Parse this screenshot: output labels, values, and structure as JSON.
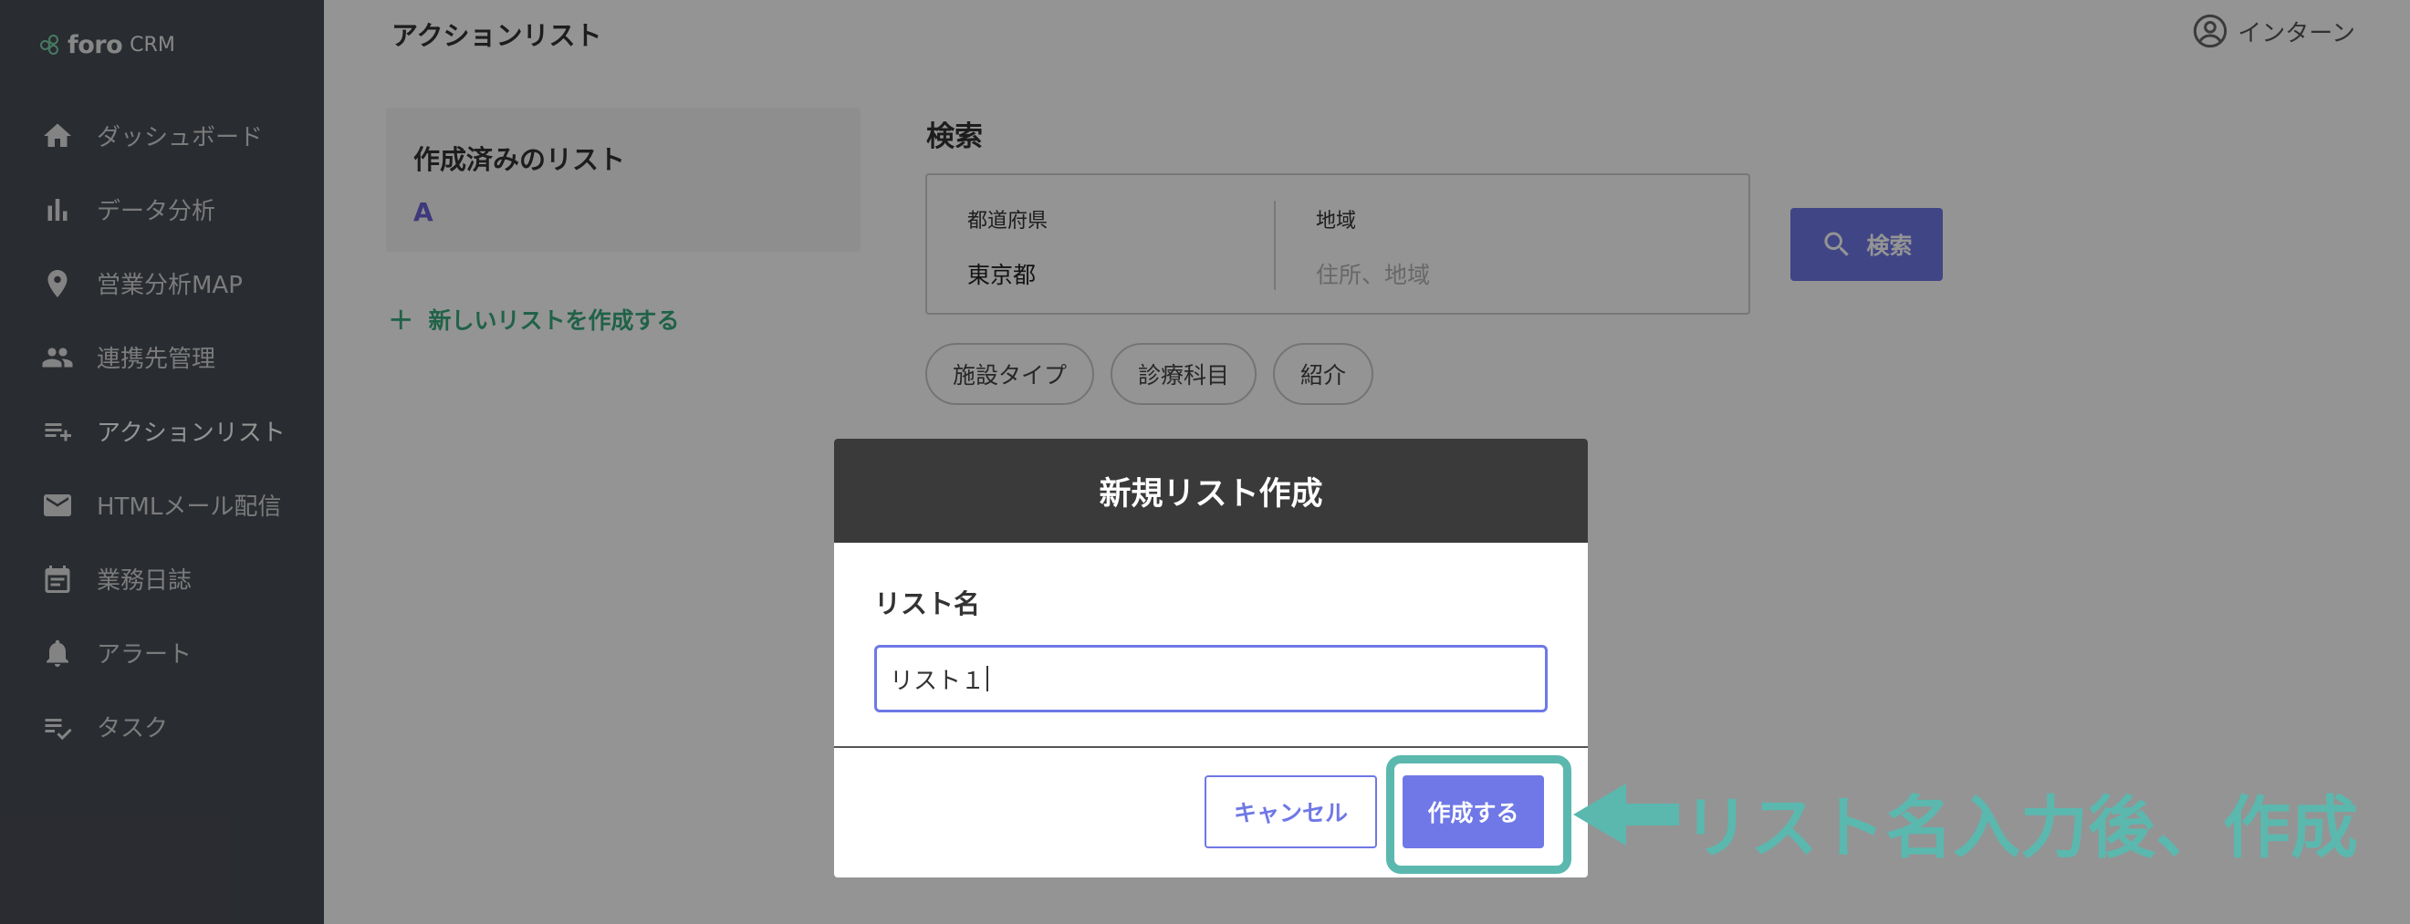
{
  "app": {
    "brand": "foro",
    "brand_suffix": "CRM"
  },
  "sidebar": {
    "items": [
      {
        "label": "ダッシュボード",
        "icon": "home-icon",
        "active": false
      },
      {
        "label": "データ分析",
        "icon": "bar-chart-icon",
        "active": false
      },
      {
        "label": "営業分析MAP",
        "icon": "map-pin-icon",
        "active": false
      },
      {
        "label": "連携先管理",
        "icon": "people-icon",
        "active": false
      },
      {
        "label": "アクションリスト",
        "icon": "playlist-add-icon",
        "active": true
      },
      {
        "label": "HTMLメール配信",
        "icon": "mail-icon",
        "active": false
      },
      {
        "label": "業務日誌",
        "icon": "calendar-icon",
        "active": false
      },
      {
        "label": "アラート",
        "icon": "bell-icon",
        "active": false
      },
      {
        "label": "タスク",
        "icon": "checklist-icon",
        "active": false
      }
    ]
  },
  "header": {
    "title": "アクションリスト",
    "user": "インターン"
  },
  "lists": {
    "heading": "作成済みのリスト",
    "items": [
      "A"
    ],
    "new_label": "新しいリストを作成する"
  },
  "search": {
    "title": "検索",
    "prefecture_label": "都道府県",
    "prefecture_value": "東京都",
    "area_label": "地域",
    "area_placeholder": "住所、地域",
    "button_label": "検索",
    "chips": [
      "施設タイプ",
      "診療科目",
      "紹介"
    ]
  },
  "modal": {
    "title": "新規リスト作成",
    "field_label": "リスト名",
    "field_value": "リスト１",
    "cancel_label": "キャンセル",
    "create_label": "作成する"
  },
  "annotation": {
    "text": "リスト名入力後、作成"
  },
  "colors": {
    "accent": "#6f78e6",
    "sidebar": "#484c55",
    "annotation": "#5bb8ae",
    "green": "#38a97d"
  }
}
